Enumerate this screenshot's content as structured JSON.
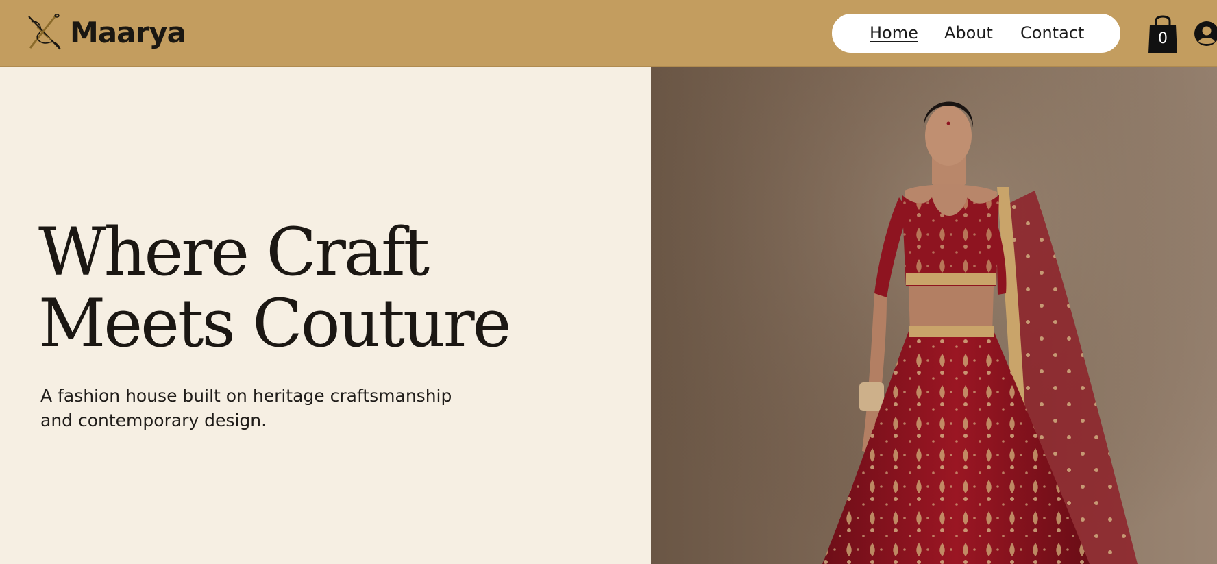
{
  "header": {
    "brand": "Maarya",
    "nav": [
      {
        "label": "Home",
        "active": true
      },
      {
        "label": "About",
        "active": false
      },
      {
        "label": "Contact",
        "active": false
      }
    ],
    "cart": {
      "count": "0",
      "icon": "shopping-bag-icon"
    },
    "account": {
      "icon": "user-avatar-icon"
    }
  },
  "hero": {
    "title_line1": "Where Craft",
    "title_line2": "Meets Couture",
    "subtitle_line1": "A fashion house built on heritage craftsmanship",
    "subtitle_line2": "and contemporary design."
  },
  "colors": {
    "header_bg": "#c39d5f",
    "page_bg": "#f6efe3",
    "text": "#1b1713",
    "garment_red": "#8e1420",
    "gold": "#c9a46a"
  }
}
